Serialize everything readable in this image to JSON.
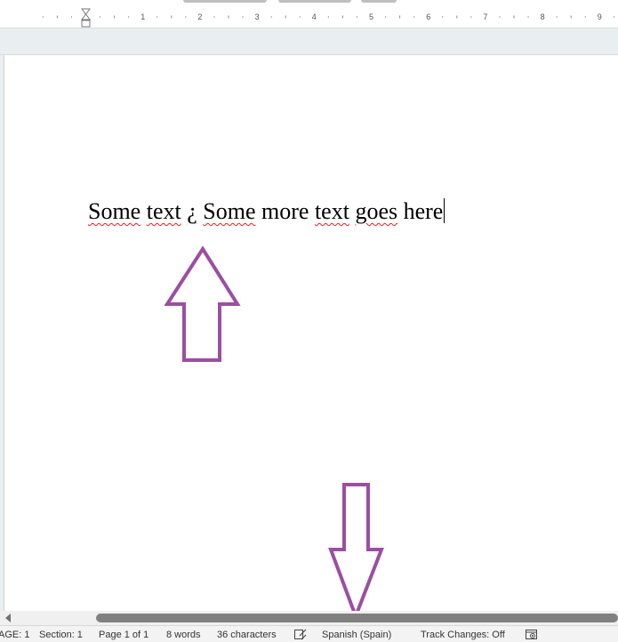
{
  "ruler": {
    "numbers": [
      "1",
      "2",
      "3",
      "4",
      "5",
      "6",
      "7",
      "8",
      "9"
    ]
  },
  "document": {
    "segments": [
      {
        "text": "Some",
        "misspelled": true
      },
      {
        "text": " ",
        "misspelled": false
      },
      {
        "text": "text",
        "misspelled": true
      },
      {
        "text": " ",
        "misspelled": false
      },
      {
        "text": "¿",
        "misspelled": true
      },
      {
        "text": " ",
        "misspelled": false
      },
      {
        "text": "Some",
        "misspelled": true
      },
      {
        "text": " more ",
        "misspelled": false
      },
      {
        "text": "text",
        "misspelled": true
      },
      {
        "text": " ",
        "misspelled": false
      },
      {
        "text": "goes",
        "misspelled": true
      },
      {
        "text": " here",
        "misspelled": false
      }
    ]
  },
  "statusbar": {
    "page_field": "AGE: 1",
    "section": "Section: 1",
    "page_of": "Page 1 of 1",
    "words": "8 words",
    "characters": "36 characters",
    "language": "Spanish (Spain)",
    "track_changes": "Track Changes: Off"
  },
  "icons": {
    "proofing": "proofing-icon",
    "macro": "macro-record-icon"
  },
  "colors": {
    "annotation_arrow": "#9c4ea3",
    "spell_squiggle": "#e02020"
  }
}
